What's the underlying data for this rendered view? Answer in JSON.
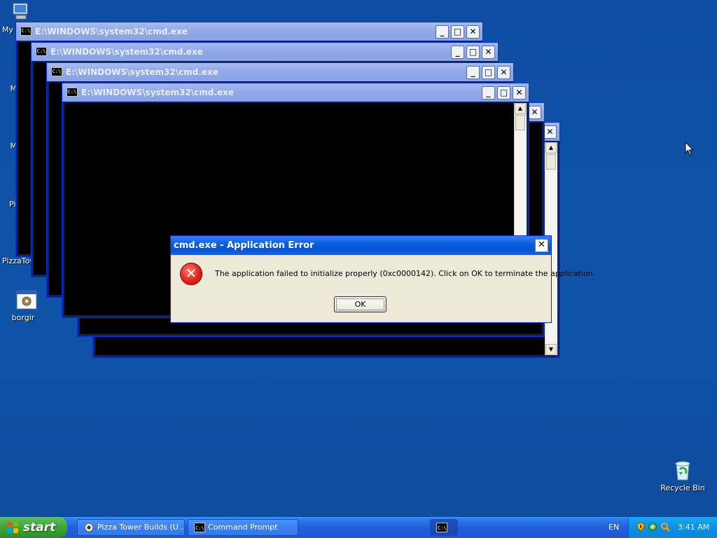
{
  "desktop": {
    "icons": [
      {
        "label": "My",
        "icon": "computer-icon"
      },
      {
        "label": "PizzaTow",
        "icon": "folder-icon"
      },
      {
        "label": "borgir",
        "icon": "application-icon"
      },
      {
        "label": "Recycle Bin",
        "icon": "recycle-bin-icon"
      }
    ],
    "partial_letters": [
      "M",
      "M",
      "Pizz"
    ]
  },
  "windows": [
    {
      "title": "E:\\WINDOWS\\system32\\cmd.exe"
    },
    {
      "title": "E:\\WINDOWS\\system32\\cmd.exe"
    },
    {
      "title": "E:\\WINDOWS\\system32\\cmd.exe"
    },
    {
      "title": "E:\\WINDOWS\\system32\\cmd.exe"
    }
  ],
  "window_controls": {
    "minimize": "_",
    "maximize": "□",
    "close": "✕"
  },
  "cmd_icon_text": "C:\\",
  "dialog": {
    "title": "cmd.exe - Application Error",
    "message": "The application failed to initialize properly (0xc0000142). Click on OK to terminate the application.",
    "ok_label": "OK",
    "close_glyph": "✕",
    "icon_glyph": "✕"
  },
  "taskbar": {
    "start_label": "start",
    "tasks": [
      {
        "label": "Pizza Tower Builds (U...",
        "icon": "browser-icon"
      },
      {
        "label": "Command Prompt",
        "icon": "cmd-icon"
      },
      {
        "label": "",
        "icon": "cmd-icon"
      }
    ],
    "language": "EN",
    "clock": "3:41 AM"
  },
  "colors": {
    "desktop": "#0f4fa3",
    "taskbar": "#245edc",
    "start": "#3da535",
    "dialog_title": "#0453d8"
  }
}
